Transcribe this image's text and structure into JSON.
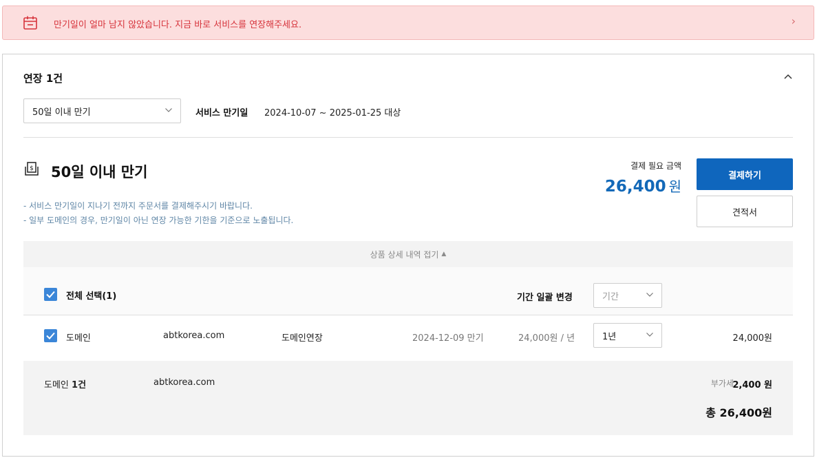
{
  "alert": {
    "message": "만기일이 얼마 남지 않았습니다. 지금 바로 서비스를 연장해주세요.",
    "icon": "calendar-icon",
    "arrow": "›",
    "colors": {
      "background": "#fcdede",
      "text": "#d6333b"
    }
  },
  "card": {
    "title": "연장 1건",
    "collapse_icon": "chevron-up-icon",
    "period_select": {
      "value": "50일 이내 만기"
    },
    "expiry": {
      "label": "서비스 만기일",
      "range": "2024-10-07 ~ 2025-01-25 대상"
    }
  },
  "section": {
    "icon": "money-bill-icon",
    "title": "50일 이내 만기",
    "notes": [
      "- 서비스 만기일이 지나기 전까지 주문서를 결제해주시기 바랍니다.",
      "- 일부 도메인의 경우, 만기일이 아닌 연장 가능한 기한을 기준으로 노출됩니다."
    ],
    "payment": {
      "label": "결제 필요 금액",
      "amount": "26,400",
      "unit": "원"
    },
    "pay_button": "결제하기",
    "quote_button": "견적서",
    "accent_color": "#0f66bd"
  },
  "detail_toggle": {
    "label": "상품 상세 내역 접기",
    "icon": "▲"
  },
  "table": {
    "select_all": {
      "label": "전체 선택(1)",
      "checked": true
    },
    "bulk_change": {
      "label": "기간 일괄 변경",
      "placeholder": "기간"
    },
    "items": [
      {
        "checked": true,
        "type": "도메인",
        "domain": "abtkorea.com",
        "service": "도메인연장",
        "expiry": "2024-12-09 만기",
        "price": "24,000원 / 년",
        "term": "1년",
        "amount": "24,000원"
      }
    ],
    "summary": {
      "count_label": "도메인",
      "count": "1건",
      "domain": "abtkorea.com",
      "vat_label": "부가세",
      "vat_value": "2,400 원",
      "total": "총 26,400원"
    }
  }
}
